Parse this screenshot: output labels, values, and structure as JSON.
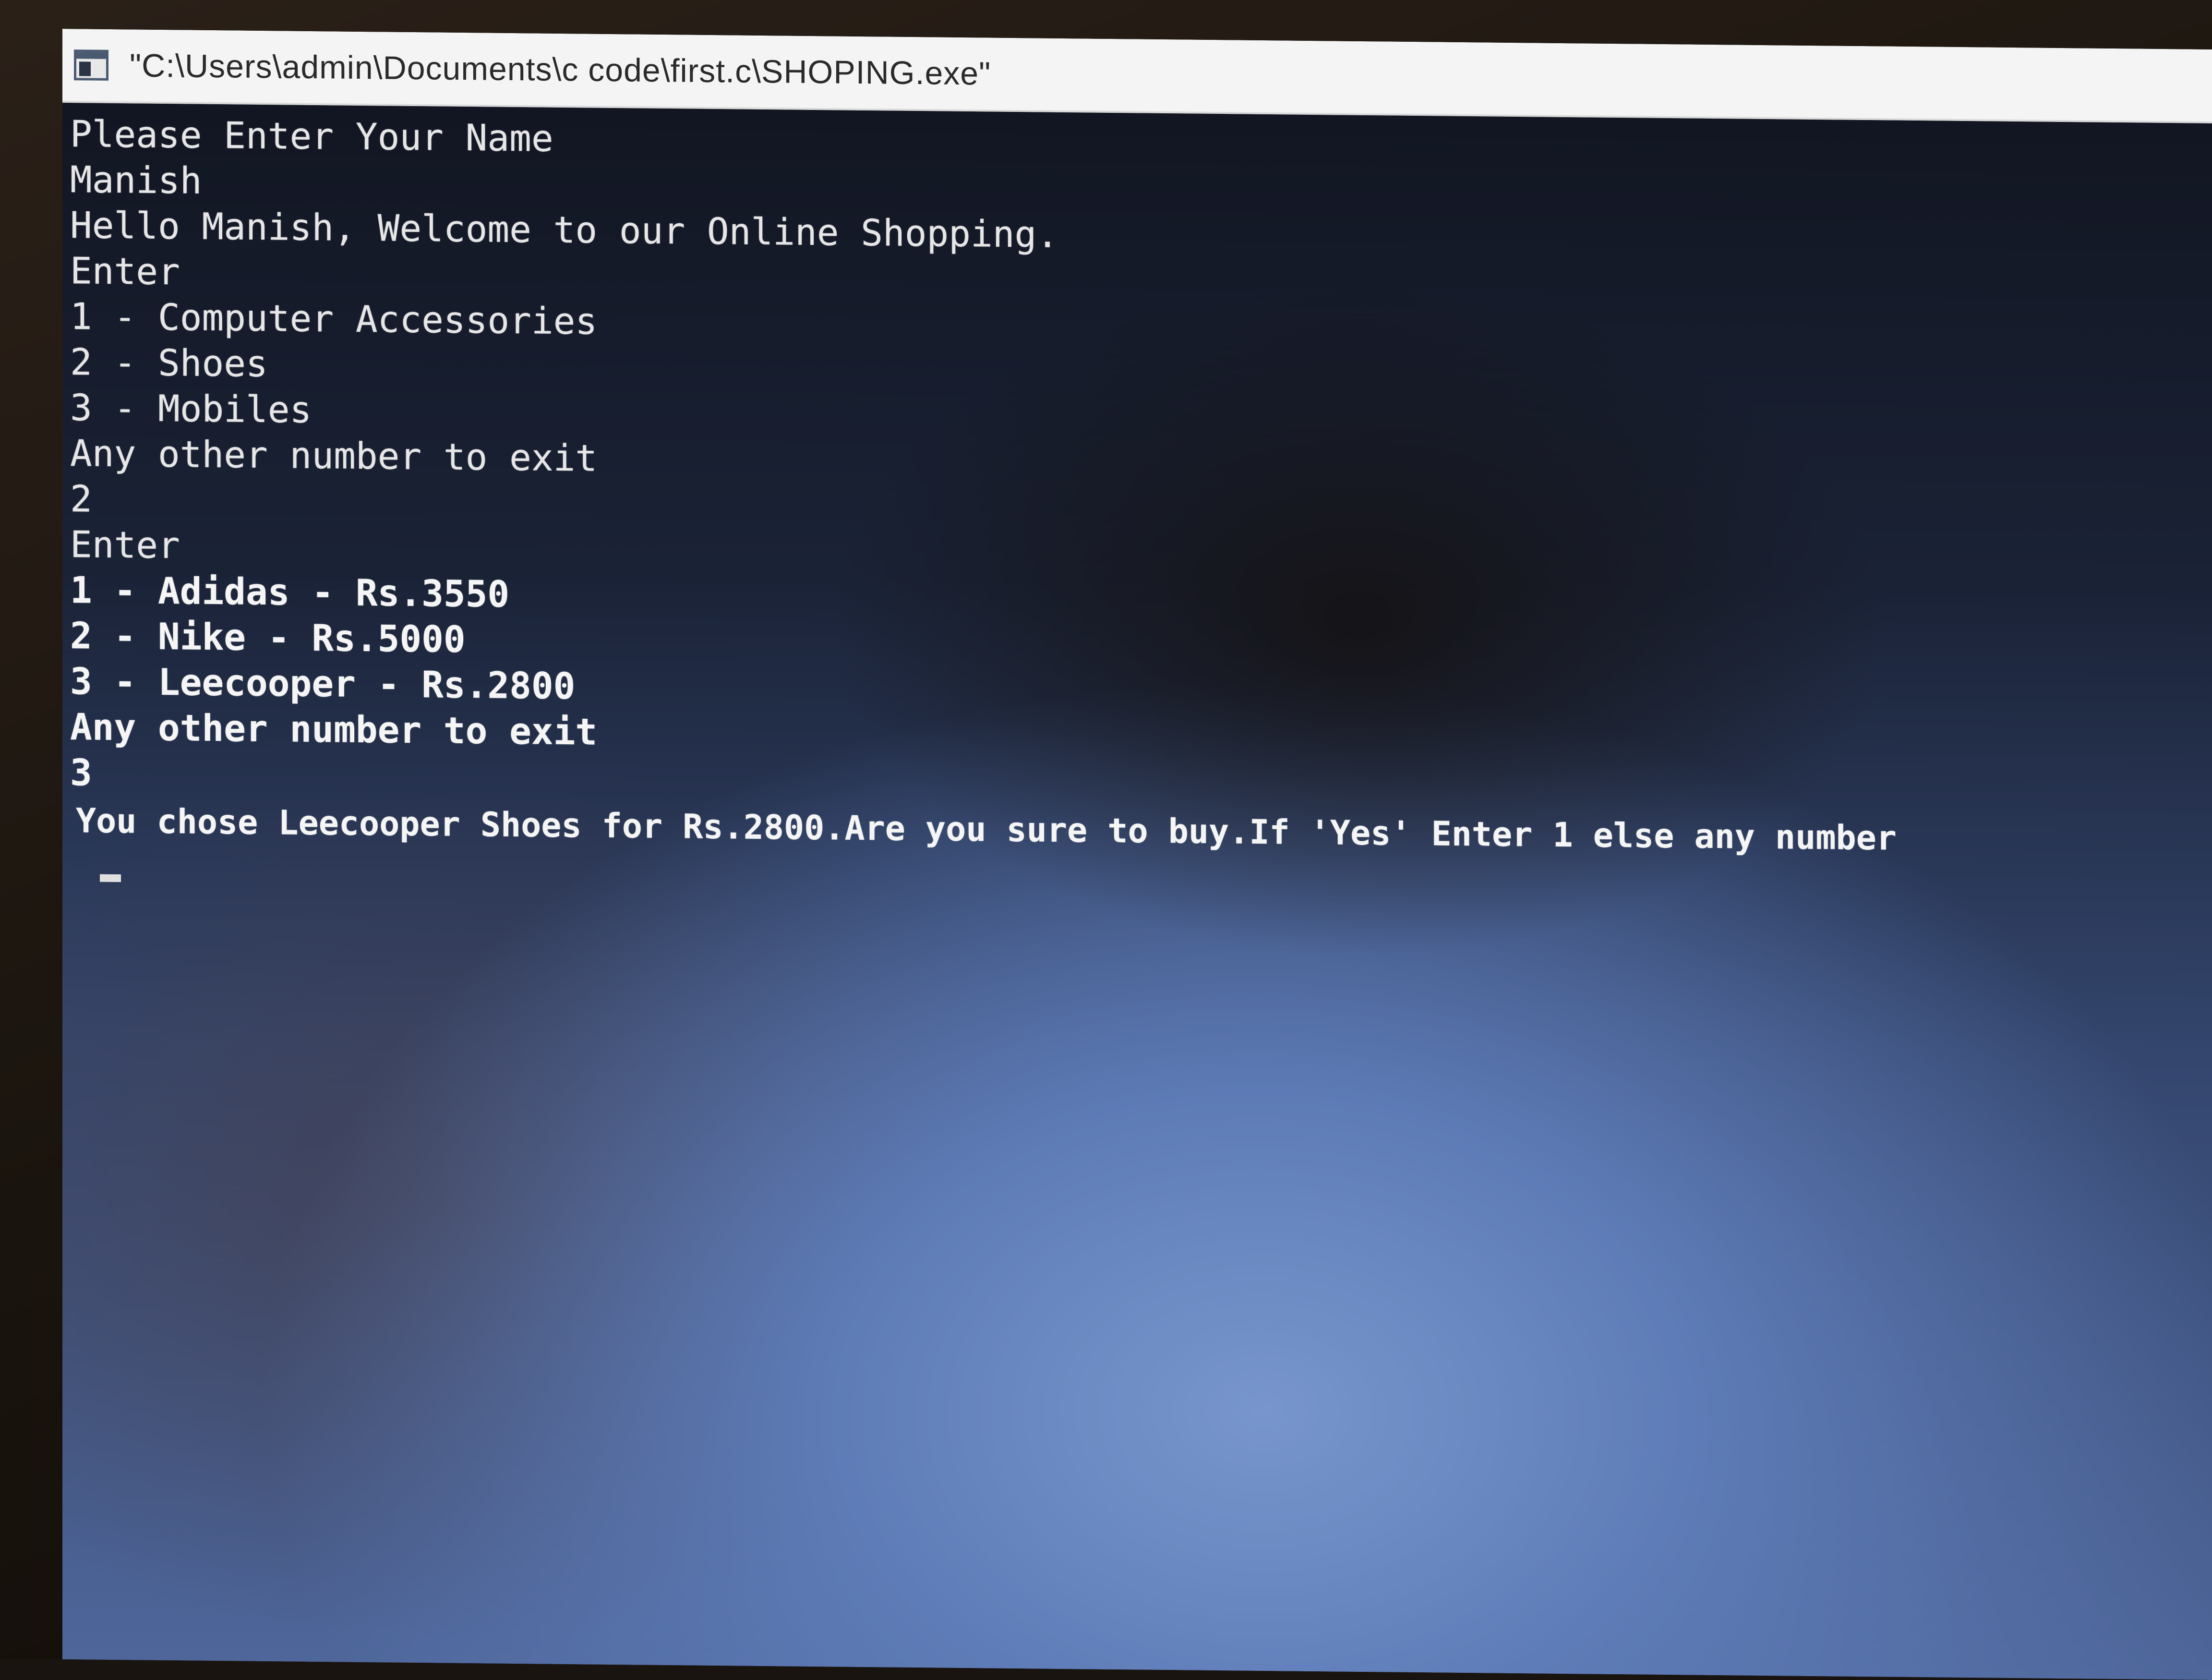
{
  "window": {
    "title": "\"C:\\Users\\admin\\Documents\\c code\\first.c\\SHOPING.exe\""
  },
  "console": {
    "lines": [
      "Please Enter Your Name",
      "Manish",
      "Hello Manish, Welcome to our Online Shopping.",
      "Enter",
      "1 - Computer Accessories",
      "2 - Shoes",
      "3 - Mobiles",
      "Any other number to exit",
      "2",
      "Enter",
      "1 - Adidas - Rs.3550",
      "2 - Nike - Rs.5000",
      "3 - Leecooper - Rs.2800",
      "Any other number to exit",
      "3",
      "You chose Leecooper Shoes for Rs.2800.Are you sure to buy.If 'Yes' Enter 1 else any number"
    ],
    "cursor": "_"
  }
}
